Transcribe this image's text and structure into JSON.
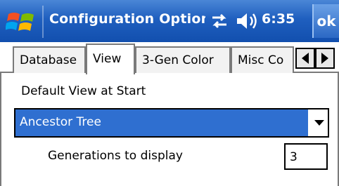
{
  "titlebar": {
    "title": "Configuration Options",
    "clock": "6:35",
    "ok_label": "ok",
    "icons": [
      "windows-start-icon",
      "connectivity-icon",
      "volume-icon"
    ]
  },
  "tabs": [
    {
      "label": "Database",
      "active": false
    },
    {
      "label": "View",
      "active": true
    },
    {
      "label": "3-Gen Color",
      "active": false
    },
    {
      "label": "Misc Co",
      "active": false
    }
  ],
  "view": {
    "default_view_label": "Default View at Start",
    "default_view_value": "Ancestor Tree",
    "generations_label": "Generations to display",
    "generations_value": "3"
  },
  "colors": {
    "titlebar": "#1f5fbf",
    "selection": "#2f6fd0"
  }
}
